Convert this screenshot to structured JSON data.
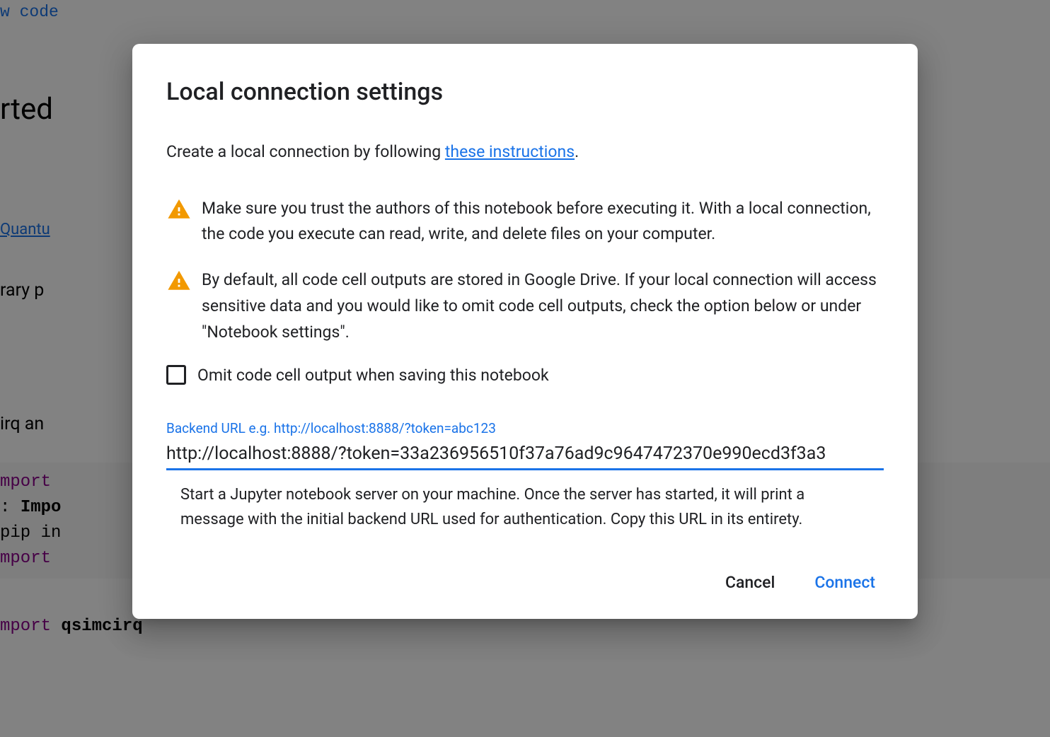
{
  "background": {
    "code_link": "w code",
    "heading": "rted",
    "quantum_link": "Quantu",
    "library_text": "rary p",
    "cirq_text": "irq an",
    "code_lines": {
      "line1_keyword": "mport",
      "line2_prefix": ": ",
      "line2_bold": "Impo",
      "line3": "pip in",
      "line4_keyword": "mport",
      "line5_keyword": "mport ",
      "line5_bold": "qsimcirq"
    }
  },
  "dialog": {
    "title": "Local connection settings",
    "intro_text": "Create a local connection by following ",
    "intro_link": "these instructions",
    "intro_suffix": ".",
    "warning1": "Make sure you trust the authors of this notebook before executing it. With a local connection, the code you execute can read, write, and delete files on your computer.",
    "warning2": "By default, all code cell outputs are stored in Google Drive. If your local connection will access sensitive data and you would like to omit code cell outputs, check the option below or under \"Notebook settings\".",
    "checkbox_label": "Omit code cell output when saving this notebook",
    "input_label": "Backend URL e.g. http://localhost:8888/?token=abc123",
    "input_value": "http://localhost:8888/?token=33a236956510f37a76ad9c9647472370e990ecd3f3a3",
    "input_help": "Start a Jupyter notebook server on your machine. Once the server has started, it will print a message with the initial backend URL used for authentication. Copy this URL in its entirety.",
    "cancel_label": "Cancel",
    "connect_label": "Connect"
  }
}
